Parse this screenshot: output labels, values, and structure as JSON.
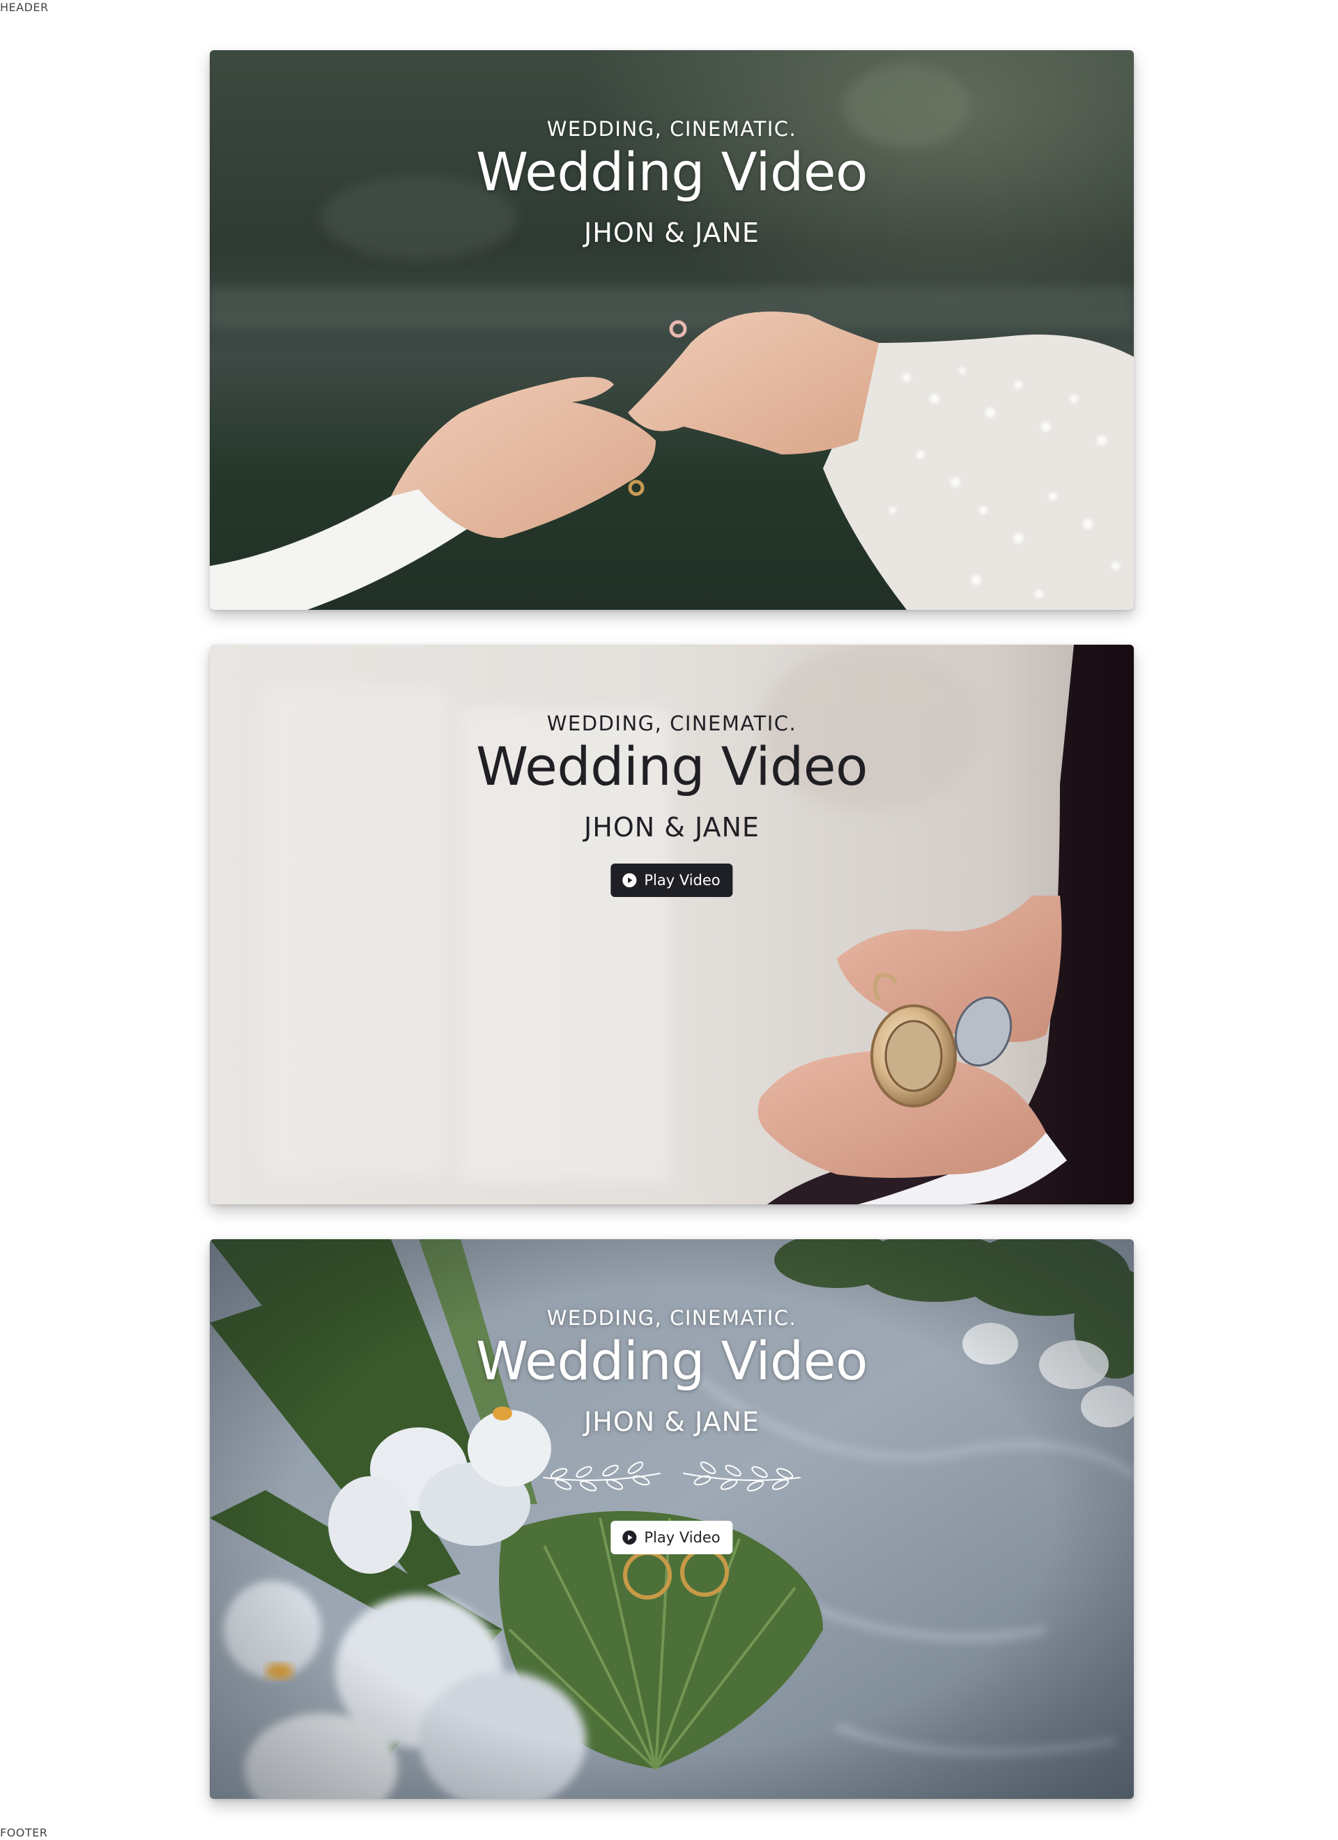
{
  "page": {
    "header_label": "HEADER",
    "footer_label": "FOOTER"
  },
  "cards": [
    {
      "eyebrow": "WEDDING, CINEMATIC.",
      "title": "Wedding Video",
      "couple": "JHON & JANE",
      "theme": "light",
      "scene": "hands-with-ring-image"
    },
    {
      "eyebrow": "WEDDING, CINEMATIC.",
      "title": "Wedding Video",
      "couple": "JHON & JANE",
      "theme": "dark",
      "scene": "pocket-watch-image",
      "button": {
        "label": "Play Video",
        "icon": "play-circle-icon",
        "style": "dark"
      }
    },
    {
      "eyebrow": "WEDDING, CINEMATIC.",
      "title": "Wedding Video",
      "couple": "JHON & JANE",
      "theme": "light",
      "scene": "orchids-and-rings-image",
      "ornament": "laurel-divider-icon",
      "button": {
        "label": "Play Video",
        "icon": "play-circle-icon",
        "style": "light"
      }
    }
  ],
  "colors": {
    "dark_button": "#1f2026",
    "light_button": "#ffffff",
    "dark_text": "#1f1f24",
    "light_text": "#ffffff"
  }
}
